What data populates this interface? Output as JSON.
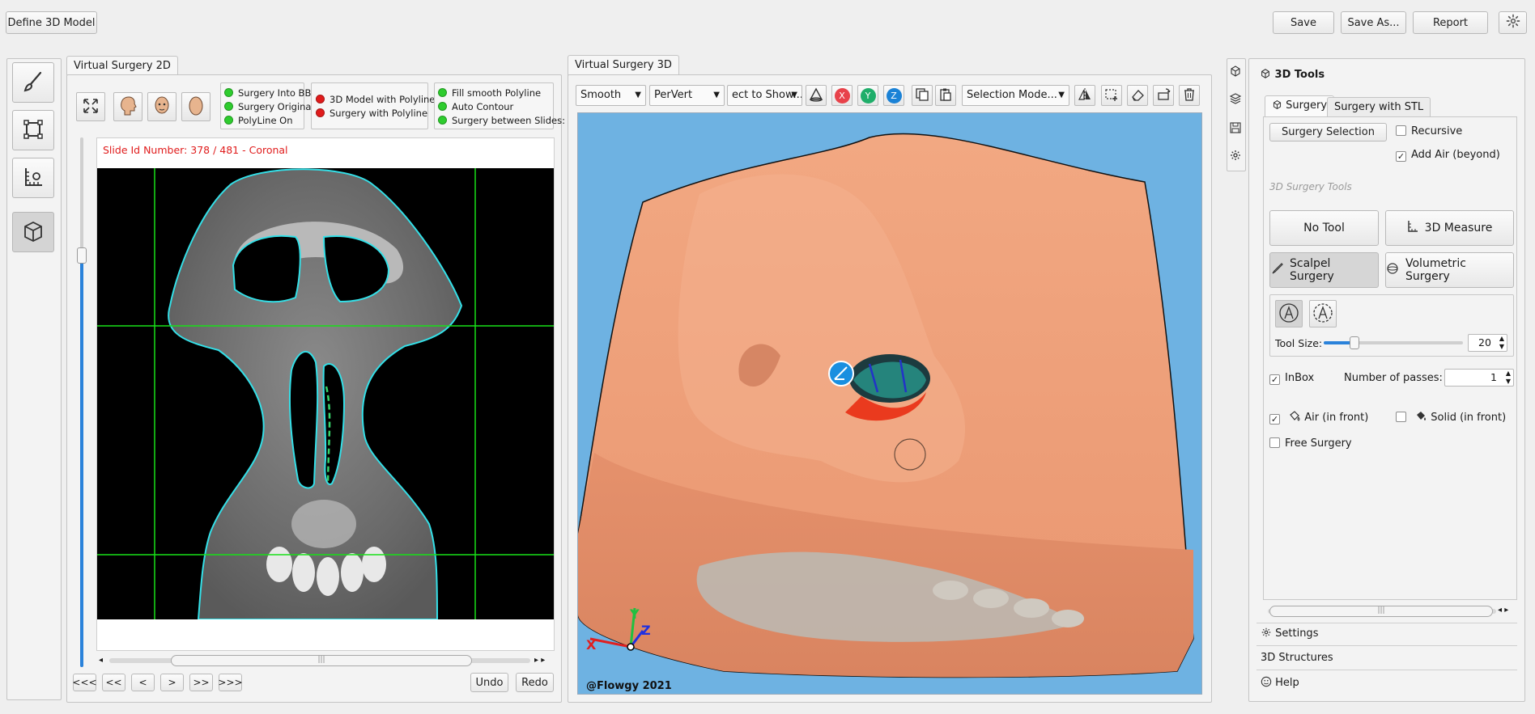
{
  "toolbar": {
    "define_model": "Define 3D Model",
    "save": "Save",
    "save_as": "Save As...",
    "report": "Report"
  },
  "panel2d": {
    "tab": "Virtual Surgery 2D",
    "indicators_a": [
      {
        "label": "Surgery Into BB",
        "color": "#2ecc2e"
      },
      {
        "label": "Surgery Original",
        "color": "#2ecc2e"
      },
      {
        "label": "PolyLine On",
        "color": "#2ecc2e"
      }
    ],
    "indicators_b": [
      {
        "label": "3D Model with Polyline",
        "color": "#e01b1b"
      },
      {
        "label": "Surgery with Polyline",
        "color": "#e01b1b"
      }
    ],
    "indicators_c": [
      {
        "label": "Fill smooth Polyline",
        "color": "#2ecc2e"
      },
      {
        "label": "Auto Contour",
        "color": "#2ecc2e"
      },
      {
        "label": "Surgery between Slides:",
        "color": "#2ecc2e"
      }
    ],
    "slide_text": "Slide Id Number: 378 / 481 - Coronal",
    "nav": [
      "<<<",
      "<<",
      "<",
      ">",
      ">>",
      ">>>"
    ],
    "undo": "Undo",
    "redo": "Redo"
  },
  "panel3d": {
    "tab": "Virtual Surgery 3D",
    "shading": "Smooth",
    "coloring": "PerVert",
    "object_select": "ect to Show...",
    "selection_mode": "Selection Mode...",
    "axis_buttons": [
      "X",
      "Y",
      "Z"
    ],
    "axis_colors": [
      "#e8424a",
      "#1fae6a",
      "#1b82d6"
    ],
    "watermark": "@Flowgy 2021",
    "axis_labels": [
      "X",
      "Y",
      "Z"
    ]
  },
  "tools": {
    "header": "3D Tools",
    "tabs": [
      "Surgery",
      "Surgery with STL"
    ],
    "surgery_selection": "Surgery Selection",
    "recursive": "Recursive",
    "add_air": "Add Air (beyond)",
    "section_label": "3D Surgery Tools",
    "no_tool": "No Tool",
    "measure": "3D Measure",
    "scalpel": "Scalpel Surgery",
    "volumetric": "Volumetric Surgery",
    "tool_size_label": "Tool Size:",
    "tool_size_value": "20",
    "tool_size_fraction": 0.2,
    "inbox": "InBox",
    "passes_label": "Number of passes:",
    "passes_value": "1",
    "air_front": "Air (in front)",
    "solid_front": "Solid (in front)",
    "free_surgery": "Free Surgery"
  },
  "accordion": {
    "settings": "Settings",
    "structures": "3D Structures",
    "help": "Help"
  }
}
